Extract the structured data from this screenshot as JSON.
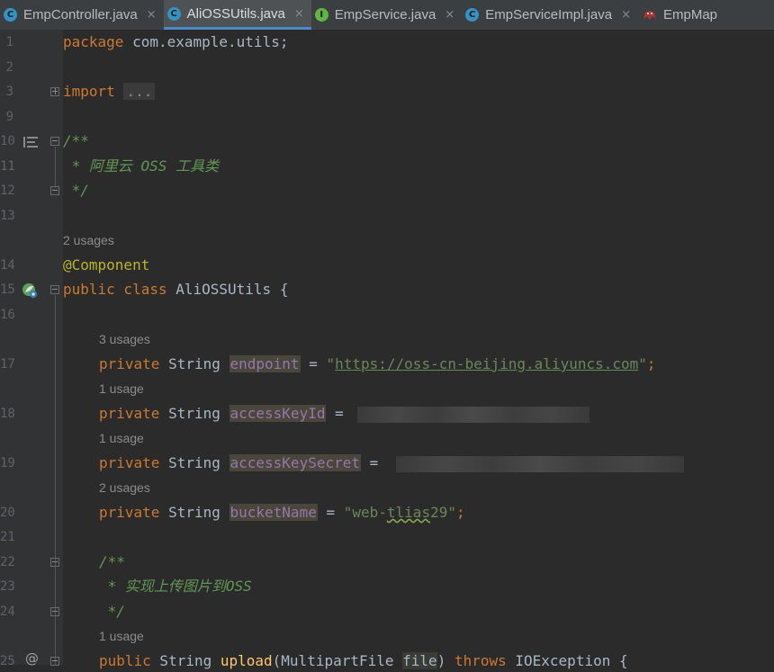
{
  "tabs": [
    {
      "icon": "C",
      "label": "EmpController.java",
      "active": false,
      "kind": "class-icon"
    },
    {
      "icon": "C",
      "label": "AliOSSUtils.java",
      "active": true,
      "kind": "class-icon"
    },
    {
      "icon": "I",
      "label": "EmpService.java",
      "active": false,
      "kind": "interface-icon"
    },
    {
      "icon": "C",
      "label": "EmpServiceImpl.java",
      "active": false,
      "kind": "class-icon"
    },
    {
      "icon": "",
      "label": "EmpMap",
      "active": false,
      "kind": "mapper-icon"
    }
  ],
  "close_glyph": "×",
  "line_numbers": [
    "1",
    "2",
    "3",
    "9",
    "10",
    "11",
    "12",
    "13",
    "14",
    "15",
    "16",
    "17",
    "18",
    "19",
    "20",
    "21",
    "22",
    "23",
    "24",
    "25"
  ],
  "code": {
    "l1_kw": "package",
    "l1_rest": " com.example.utils;",
    "l3_kw": "import",
    "l3_folded": "...",
    "l10": "/**",
    "l11": " * 阿里云 OSS 工具类",
    "l12": " */",
    "u14": "2 usages",
    "l14": "@Component",
    "l15_kw": "public class",
    "l15_rest": " AliOSSUtils {",
    "u17": "3 usages",
    "l17_kw": "private",
    "l17_type": " String ",
    "l17_field": "endpoint",
    "l17_eq": " = ",
    "l17_q1": "\"",
    "l17_url": "https://oss-cn-beijing.aliyuncs.com",
    "l17_q2": "\"",
    "l17_end": ";",
    "u18": "1 usage",
    "l18_kw": "private",
    "l18_type": " String ",
    "l18_field": "accessKeyId",
    "l18_eq": " = ",
    "u19": "1 usage",
    "l19_kw": "private",
    "l19_type": " String ",
    "l19_field": "accessKeySecret",
    "l19_eq": " = ",
    "u20": "2 usages",
    "l20_kw": "private",
    "l20_type": " String ",
    "l20_field": "bucketName",
    "l20_eq": " = ",
    "l20_s1": "\"web-",
    "l20_s2": "tlias",
    "l20_s3": "29\"",
    "l20_end": ";",
    "l22": "/**",
    "l23": " * 实现上传图片到OSS",
    "l24": " */",
    "u25": "1 usage",
    "l25_kw1": "public",
    "l25_type": " String ",
    "l25_fn": "upload",
    "l25_p1": "(MultipartFile ",
    "l25_param": "file",
    "l25_p2": ") ",
    "l25_kw2": "throws",
    "l25_rest": " IOException {"
  },
  "colors": {
    "background": "#2b2b2b",
    "gutter": "#313335",
    "keyword": "#cc7832",
    "annotation": "#bbb529",
    "string": "#6a8759",
    "field": "#9876aa",
    "method": "#ffc66d",
    "doc_comment": "#629755",
    "active_tab_underline": "#4a88c7"
  }
}
